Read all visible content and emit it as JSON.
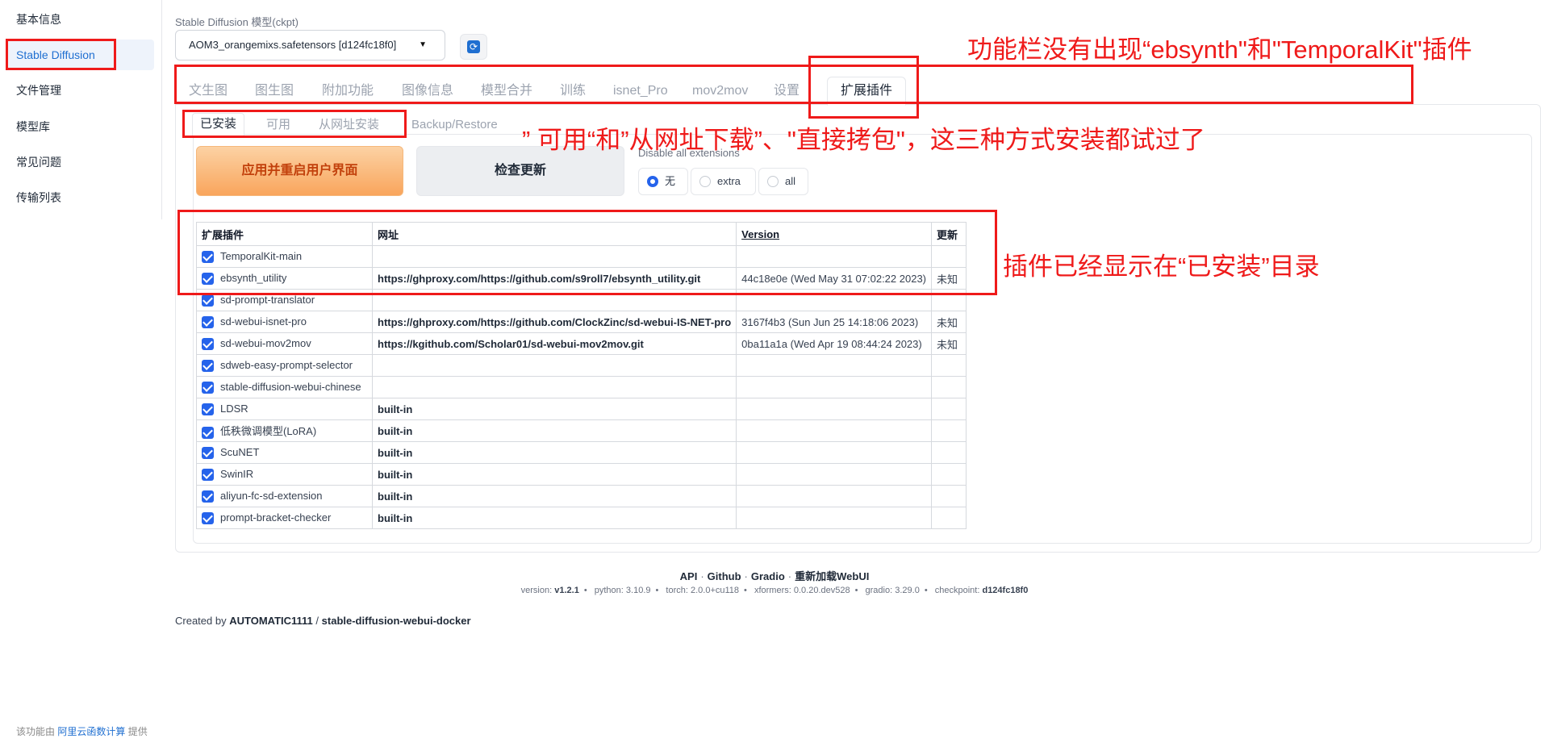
{
  "sidebar": {
    "items": [
      {
        "label": "基本信息"
      },
      {
        "label": "Stable Diffusion"
      },
      {
        "label": "文件管理"
      },
      {
        "label": "模型库"
      },
      {
        "label": "常见问题"
      },
      {
        "label": "传输列表"
      }
    ],
    "footer": {
      "prefix": "该功能由",
      "link": "阿里云函数计算",
      "suffix": "提供"
    }
  },
  "ckpt": {
    "label": "Stable Diffusion 模型(ckpt)",
    "value": "AOM3_orangemixs.safetensors [d124fc18f0]"
  },
  "main_tabs": [
    "文生图",
    "图生图",
    "附加功能",
    "图像信息",
    "模型合并",
    "训练",
    "isnet_Pro",
    "mov2mov",
    "设置",
    "扩展插件"
  ],
  "sub_tabs": [
    "已安装",
    "可用",
    "从网址安装",
    "Backup/Restore"
  ],
  "actions": {
    "apply": "应用并重启用户界面",
    "check": "检查更新",
    "disable_label": "Disable all extensions",
    "radios": [
      "无",
      "extra",
      "all"
    ],
    "radio_selected": "无"
  },
  "table": {
    "headers": [
      "扩展插件",
      "网址",
      "Version",
      "更新"
    ],
    "rows": [
      {
        "name": "TemporalKit-main",
        "url": "",
        "version": "",
        "update": ""
      },
      {
        "name": "ebsynth_utility",
        "url": "https://ghproxy.com/https://github.com/s9roll7/ebsynth_utility.git",
        "version": "44c18e0e (Wed May 31 07:02:22 2023)",
        "update": "未知"
      },
      {
        "name": "sd-prompt-translator",
        "url": "",
        "version": "",
        "update": ""
      },
      {
        "name": "sd-webui-isnet-pro",
        "url": "https://ghproxy.com/https://github.com/ClockZinc/sd-webui-IS-NET-pro",
        "version": "3167f4b3 (Sun Jun 25 14:18:06 2023)",
        "update": "未知"
      },
      {
        "name": "sd-webui-mov2mov",
        "url": "https://kgithub.com/Scholar01/sd-webui-mov2mov.git",
        "version": "0ba11a1a (Wed Apr 19 08:44:24 2023)",
        "update": "未知"
      },
      {
        "name": "sdweb-easy-prompt-selector",
        "url": "",
        "version": "",
        "update": ""
      },
      {
        "name": "stable-diffusion-webui-chinese",
        "url": "",
        "version": "",
        "update": ""
      },
      {
        "name": "LDSR",
        "url": "built-in",
        "version": "",
        "update": ""
      },
      {
        "name": "低秩微调模型(LoRA)",
        "url": "built-in",
        "version": "",
        "update": ""
      },
      {
        "name": "ScuNET",
        "url": "built-in",
        "version": "",
        "update": ""
      },
      {
        "name": "SwinIR",
        "url": "built-in",
        "version": "",
        "update": ""
      },
      {
        "name": "aliyun-fc-sd-extension",
        "url": "built-in",
        "version": "",
        "update": ""
      },
      {
        "name": "prompt-bracket-checker",
        "url": "built-in",
        "version": "",
        "update": ""
      }
    ]
  },
  "footer": {
    "links": [
      "API",
      "Github",
      "Gradio",
      "重新加载WebUI"
    ],
    "versions": [
      {
        "label": "version:",
        "value": "v1.2.1"
      },
      {
        "label": "python:",
        "value": "3.10.9"
      },
      {
        "label": "torch:",
        "value": "2.0.0+cu118"
      },
      {
        "label": "xformers:",
        "value": "0.0.20.dev528"
      },
      {
        "label": "gradio:",
        "value": "3.29.0"
      },
      {
        "label": "checkpoint:",
        "value": "d124fc18f0"
      }
    ],
    "created_prefix": "Created by",
    "created_author": "AUTOMATIC1111",
    "created_sep": "/",
    "created_repo": "stable-diffusion-webui-docker"
  },
  "annotations": {
    "tabs_note": "功能栏没有出现“ebsynth\"和\"TemporalKit\"插件",
    "install_note": "” 可用“和”从网址下载”、\"直接拷包\"，这三种方式安装都试过了",
    "table_note": "插件已经显示在“已安装”目录"
  },
  "colors": {
    "annotation": "#ef1a1a",
    "accent": "#1f6fd1",
    "checkbox": "#2563eb",
    "apply_button": "#f9a55c"
  }
}
